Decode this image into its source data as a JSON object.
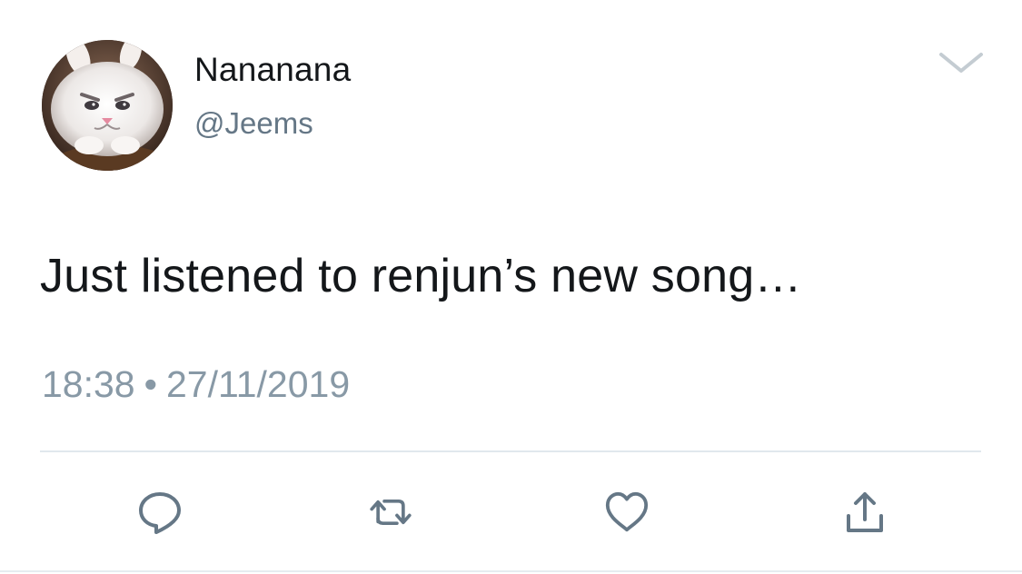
{
  "tweet": {
    "display_name": "Nananana",
    "handle": "@Jeems",
    "text": "Just listened to renjun’s new song…",
    "time": "18:38",
    "separator": "•",
    "date": "27/11/2019"
  },
  "icons": {
    "avatar": "avatar-rabbit",
    "menu": "chevron-down-icon",
    "reply": "reply-icon",
    "retweet": "retweet-icon",
    "like": "heart-icon",
    "share": "share-icon"
  },
  "colors": {
    "text": "#14171a",
    "secondary": "#657786",
    "meta": "#8899a6",
    "icon": "#657786",
    "divider": "#e1e8ed"
  }
}
